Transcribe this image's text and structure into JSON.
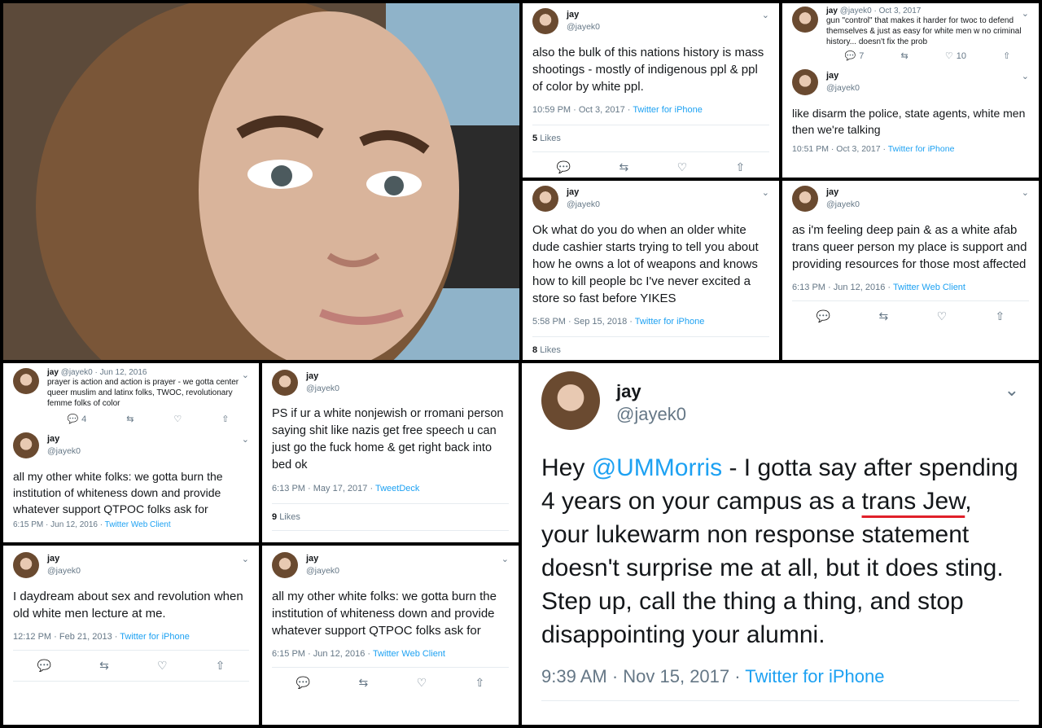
{
  "tweets": {
    "t1": {
      "name": "jay",
      "handle": "@jayek0",
      "text": "also the bulk of this nations history is mass shootings - mostly of indigenous ppl & ppl of color by white ppl.",
      "time": "10:59 PM · Oct 3, 2017 · ",
      "client": "Twitter for iPhone",
      "likes_count": "5",
      "likes_label": "Likes"
    },
    "t2a": {
      "name": "jay",
      "handle_date": "@jayek0 · Oct 3, 2017",
      "text": "gun \"control\" that makes it harder for twoc to defend themselves & just as easy for white men w no criminal history... doesn't fix the prob",
      "replies": "7",
      "favs": "10"
    },
    "t2b": {
      "name": "jay",
      "handle": "@jayek0",
      "text": "like disarm the police, state agents, white men then we're talking",
      "time": "10:51 PM · Oct 3, 2017 · ",
      "client": "Twitter for iPhone"
    },
    "t3": {
      "name": "jay",
      "handle": "@jayek0",
      "text": "Ok what do you do when an older white dude cashier starts trying to tell you about how he owns a lot of weapons and knows how to kill people bc I've never excited a store so fast before YIKES",
      "time": "5:58 PM · Sep 15, 2018 · ",
      "client": "Twitter for iPhone",
      "likes_count": "8",
      "likes_label": "Likes"
    },
    "t4": {
      "name": "jay",
      "handle": "@jayek0",
      "text": "as i'm feeling deep pain & as a white afab trans queer person my place is support and providing resources for those most affected",
      "time": "6:13 PM · Jun 12, 2016 · ",
      "client": "Twitter Web Client"
    },
    "t5a": {
      "name": "jay",
      "handle_date": "@jayek0 · Jun 12, 2016",
      "text": "prayer is action and action is prayer - we gotta center queer muslim and latinx folks, TWOC, revolutionary femme folks of color",
      "replies": "4"
    },
    "t5b": {
      "name": "jay",
      "handle": "@jayek0",
      "text": "all my other white folks: we gotta burn the institution of whiteness down and provide whatever support QTPOC folks ask for",
      "time": "6:15 PM · Jun 12, 2016 · ",
      "client": "Twitter Web Client"
    },
    "t6": {
      "name": "jay",
      "handle": "@jayek0",
      "text": "PS if ur a white nonjewish or rromani person saying shit like nazis get free speech u can just go the fuck home & get right back into bed ok",
      "time": "6:13 PM · May 17, 2017 · ",
      "client": "TweetDeck",
      "likes_count": "9",
      "likes_label": "Likes"
    },
    "t7": {
      "name": "jay",
      "handle": "@jayek0",
      "text": "I daydream about sex and revolution when old white men lecture at me.",
      "time": "12:12 PM · Feb 21, 2013 · ",
      "client": "Twitter for iPhone"
    },
    "t8": {
      "name": "jay",
      "handle": "@jayek0",
      "text": "all my other white folks: we gotta burn the institution of whiteness down and provide whatever support QTPOC folks ask for",
      "time": "6:15 PM · Jun 12, 2016 · ",
      "client": "Twitter Web Client"
    },
    "big": {
      "name": "jay",
      "handle": "@jayek0",
      "text_pre": "Hey ",
      "mention": "@UMMorris",
      "text_mid": " - I gotta say after spending 4 years on your campus as a ",
      "underlined": "trans Jew",
      "text_post": ", your lukewarm non response statement doesn't surprise me at all, but it does sting. Step up, call the thing a thing, and stop disappointing your alumni.",
      "time": "9:39 AM · Nov 15, 2017 · ",
      "client": "Twitter for iPhone"
    }
  },
  "icons": {
    "reply": "reply-icon",
    "retweet": "retweet-icon",
    "like": "heart-icon",
    "share": "share-icon",
    "chevron": "chevron-down-icon"
  },
  "colors": {
    "link": "#1da1f2",
    "underline": "#e0202a",
    "muted": "#657786"
  }
}
